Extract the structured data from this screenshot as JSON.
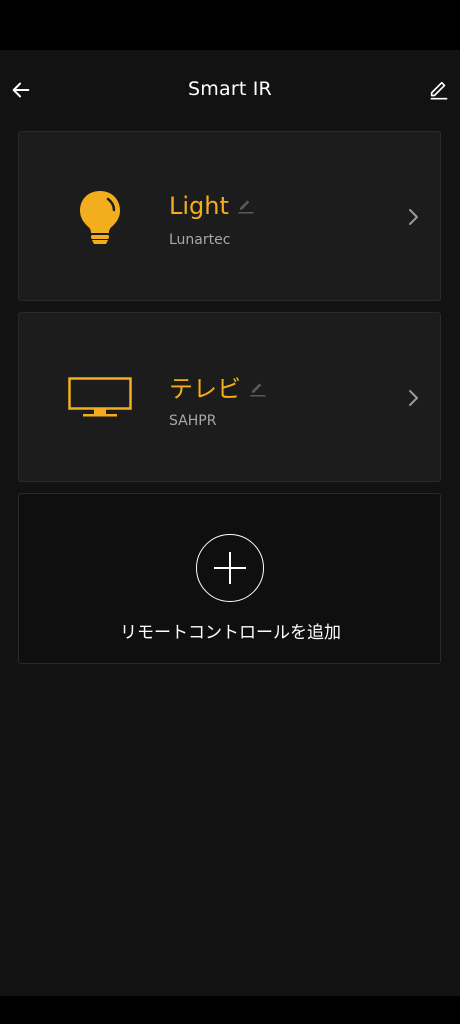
{
  "header": {
    "title": "Smart IR",
    "back_icon": "arrow-left-icon",
    "edit_icon": "pencil-icon"
  },
  "remotes": [
    {
      "name": "Light",
      "brand": "Lunartec",
      "icon": "lightbulb-icon"
    },
    {
      "name": "テレビ",
      "brand": "SAHPR",
      "icon": "tv-icon"
    }
  ],
  "add_remote": {
    "label": "リモートコントロールを追加",
    "icon": "plus-icon"
  },
  "colors": {
    "accent": "#f2ae1c",
    "background": "#121212",
    "card": "#1c1c1c",
    "subtext": "#a8a8a8"
  }
}
